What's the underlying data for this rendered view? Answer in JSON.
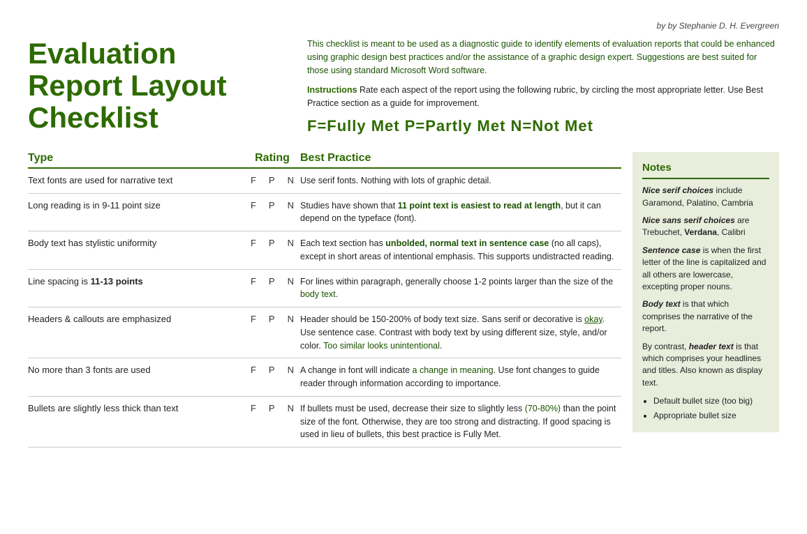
{
  "byline": "by Stephanie D. H. Evergreen",
  "title": "Evaluation\nReport Layout\nChecklist",
  "intro": "This checklist is meant to be used as a diagnostic guide to identify elements of evaluation reports that could be enhanced using graphic design best practices and/or the assistance of a graphic design expert. Suggestions are best suited for those using standard Microsoft Word software.",
  "instructions_label": "Instructions",
  "instructions_body": "Rate each aspect of the report using the following rubric, by circling the most appropriate letter. Use Best Practice section as a guide for improvement.",
  "rating_scale": "F=Fully Met     P=Partly Met     N=Not Met",
  "columns": {
    "type": "Type",
    "rating": "Rating",
    "best_practice": "Best Practice"
  },
  "rows": [
    {
      "type": "Text fonts are used for narrative text",
      "ratings": [
        "F",
        "P",
        "N"
      ],
      "best_practice": "Use serif fonts. Nothing with lots of graphic detail."
    },
    {
      "type": "Long reading is in 9-11 point size",
      "ratings": [
        "F",
        "P",
        "N"
      ],
      "best_practice": "Studies have shown that 11 point text is easiest to read at length, but it can depend on the typeface (font)."
    },
    {
      "type": "Body text has stylistic uniformity",
      "ratings": [
        "F",
        "P",
        "N"
      ],
      "best_practice": "Each text section has unbolded, normal text in sentence case (no all caps), except in short areas of intentional emphasis. This supports undistracted reading."
    },
    {
      "type": "Line spacing is 11-13 points",
      "ratings": [
        "F",
        "P",
        "N"
      ],
      "best_practice": "For lines within paragraph, generally choose 1-2 points larger than the size of the body text."
    },
    {
      "type": "Headers & callouts are emphasized",
      "ratings": [
        "F",
        "P",
        "N"
      ],
      "best_practice": "Header should be 150-200% of body text size. Sans serif or decorative is okay. Use sentence case. Contrast with body text by using different size, style, and/or color. Too similar looks unintentional."
    },
    {
      "type": "No more than 3 fonts are used",
      "ratings": [
        "F",
        "P",
        "N"
      ],
      "best_practice": "A change in font will indicate a change in meaning. Use font changes to guide reader through information according to importance."
    },
    {
      "type": "Bullets are slightly less thick than text",
      "ratings": [
        "F",
        "P",
        "N"
      ],
      "best_practice": "If bullets must be used, decrease their size to slightly less (70-80%) than the point size of the font. Otherwise, they are too strong and distracting. If good spacing is used in lieu of bullets, this best practice is Fully Met."
    }
  ],
  "notes": {
    "header": "Notes",
    "paragraphs": [
      {
        "italic_bold": "Nice serif choices",
        "rest": " include Garamond, Palatino, Cambria"
      },
      {
        "italic_bold": "Nice sans serif choices",
        "rest": " are Trebuchet, Verdana, Calibri"
      },
      {
        "italic_bold": "Sentence case",
        "rest": " is when the first letter of the line is capitalized and all others are lowercase, excepting proper nouns."
      },
      {
        "italic_bold": "Body text",
        "rest": " is that which comprises the narrative of the report."
      },
      {
        "text": "By contrast, ",
        "italic_bold": "header text",
        "rest": " is that which comprises your headlines and titles. Also known as display text."
      }
    ],
    "bullets": [
      "Default bullet size (too big)",
      "Appropriate bullet size"
    ]
  }
}
